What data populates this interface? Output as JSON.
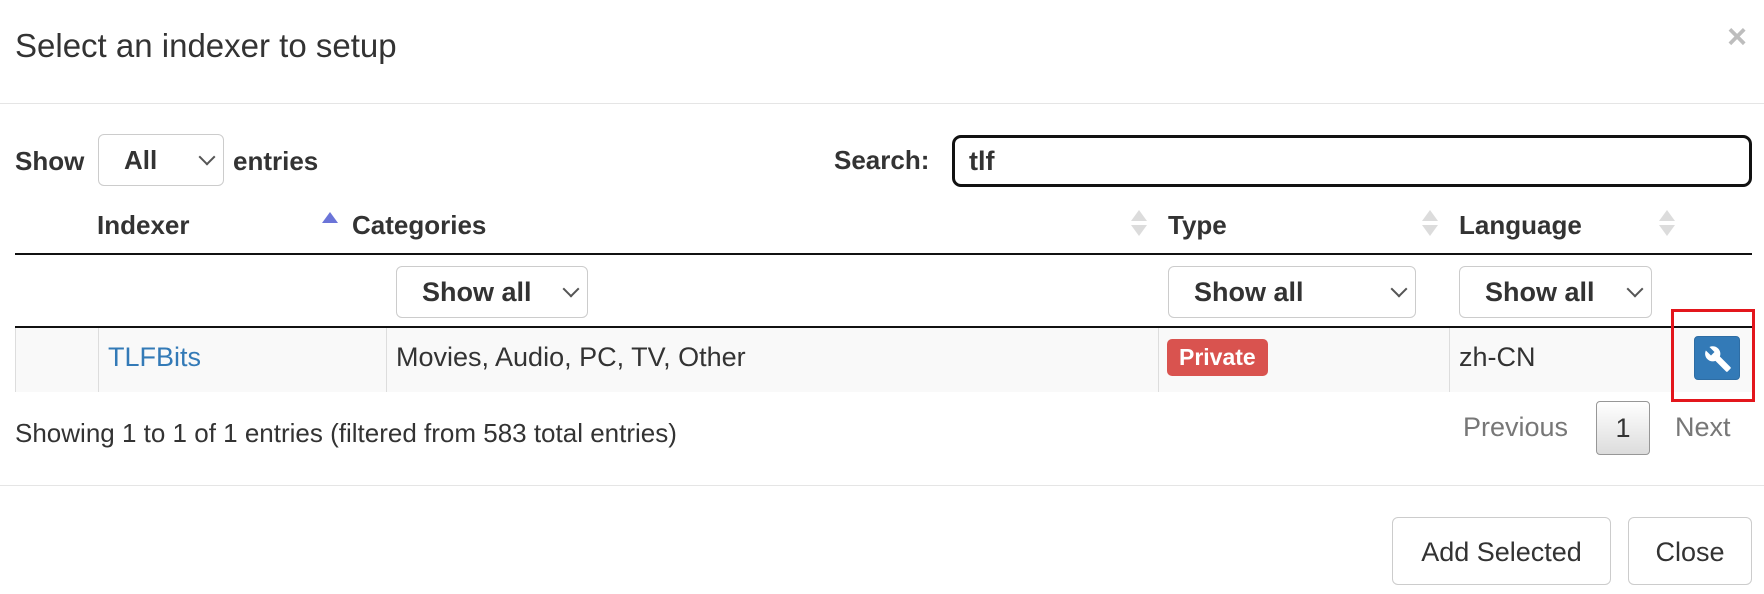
{
  "modal": {
    "title": "Select an indexer to setup",
    "close_symbol": "×"
  },
  "controls": {
    "show_label": "Show",
    "length_value": "All",
    "entries_label": "entries",
    "search_label": "Search:",
    "search_value": "tlf"
  },
  "table": {
    "columns": [
      "Indexer",
      "Categories",
      "Type",
      "Language"
    ],
    "sorted_column": "Indexer",
    "filters": {
      "categories": "Show all",
      "type": "Show all",
      "language": "Show all"
    },
    "rows": [
      {
        "indexer": "TLFBits",
        "categories": "Movies, Audio, PC, TV, Other",
        "type": "Private",
        "language": "zh-CN",
        "config_icon": "wrench-icon"
      }
    ]
  },
  "info": "Showing 1 to 1 of 1 entries (filtered from 583 total entries)",
  "pagination": {
    "previous": "Previous",
    "current": "1",
    "next": "Next"
  },
  "footer": {
    "add_selected": "Add Selected",
    "close": "Close"
  },
  "colors": {
    "link": "#337ab7",
    "private_badge": "#d9534f",
    "config_button": "#337ab7",
    "highlight": "#e3161c",
    "sort_active": "#6b74d8"
  }
}
